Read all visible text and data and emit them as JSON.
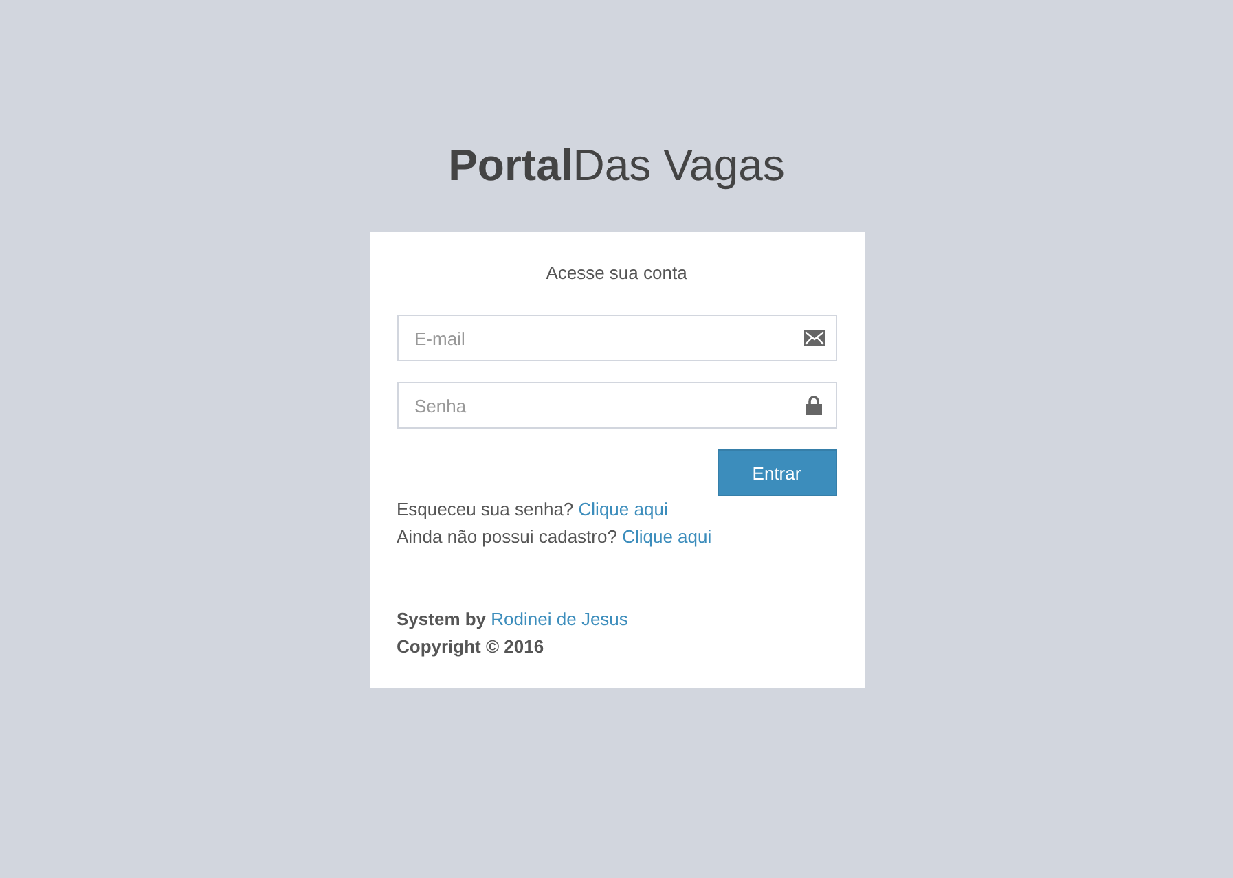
{
  "logo": {
    "text": "**Portal**Das Vagas"
  },
  "login_box": {
    "message": "Acesse sua conta",
    "email_field": {
      "placeholder": "E-mail"
    },
    "password_field": {
      "placeholder": "Senha"
    },
    "submit_button": "Entrar",
    "links": [
      {
        "text": "Esqueceu sua senha?",
        "link": "Clique aqui"
      },
      {
        "text": "Ainda não possui cadastro?",
        "link": "Clique aqui"
      }
    ],
    "footer": {
      "credit": "System by",
      "author": "Rodinei de Jesus",
      "copyright": "Copyright © 2016"
    }
  }
}
